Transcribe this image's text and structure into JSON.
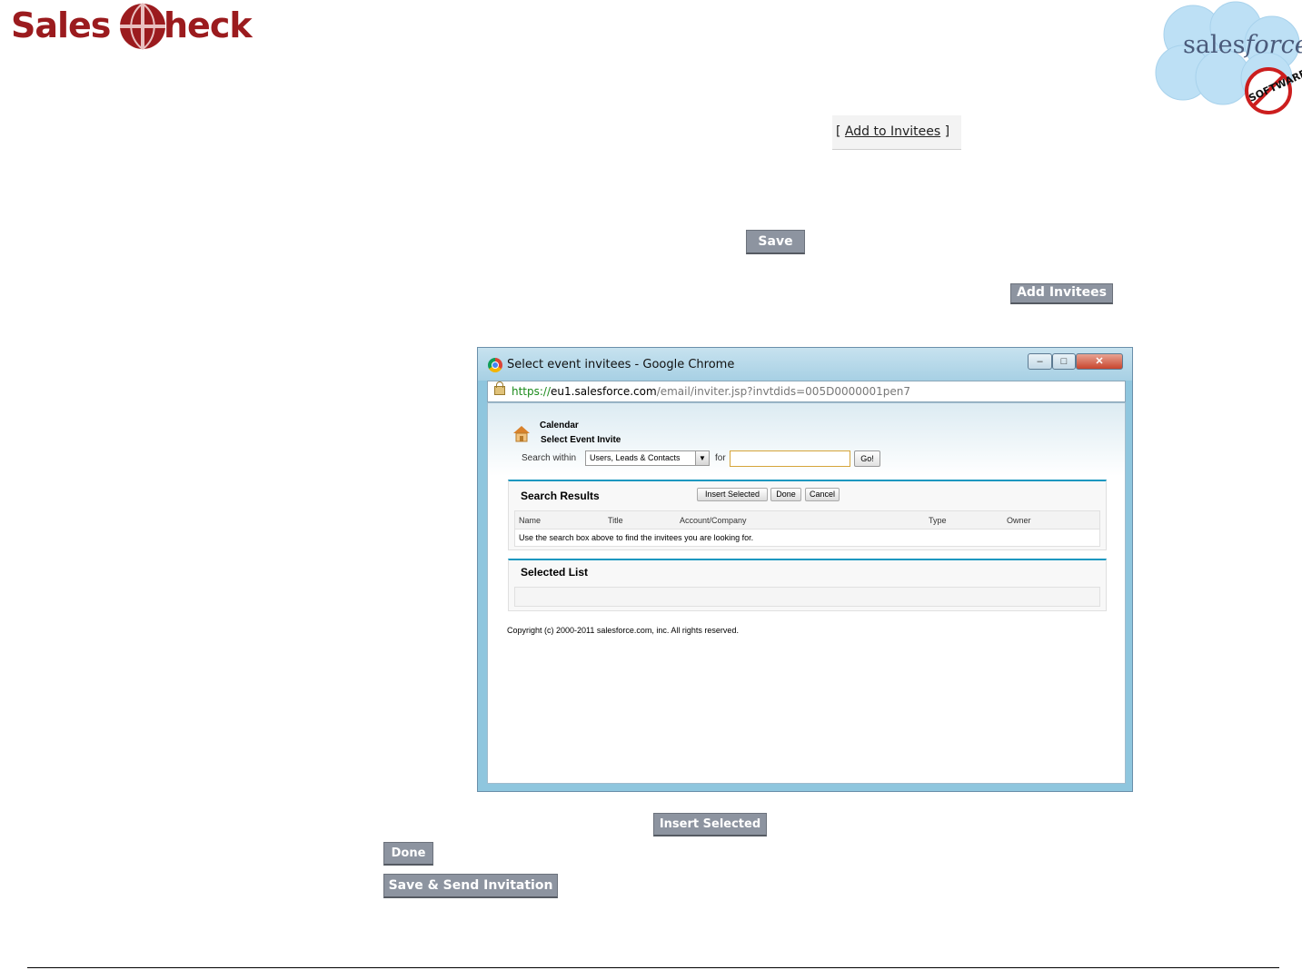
{
  "header": {
    "logo_left_a": "Sales",
    "logo_left_b": "heck",
    "logo_right_a": "sales",
    "logo_right_b": "force",
    "logo_right_stamp": "SOFTWARE"
  },
  "link_add_to_invitees": {
    "open": "[ ",
    "label": "Add to Invitees",
    "close": " ]"
  },
  "buttons": {
    "save": "Save",
    "add_invitees": "Add Invitees",
    "insert_selected": "Insert Selected",
    "done": "Done",
    "save_send": "Save & Send Invitation"
  },
  "popup": {
    "window_title": "Select event invitees - Google Chrome",
    "url_https": "https://",
    "url_host": "eu1.salesforce.com",
    "url_path": "/email/inviter.jsp?invtdids=005D0000001pen7",
    "breadcrumb": "Calendar",
    "page_title": "Select Event Invite",
    "search_within_label": "Search within",
    "search_within_value": "Users, Leads & Contacts",
    "for_label": "for",
    "search_value": "",
    "go_label": "Go!",
    "search_results": {
      "title": "Search Results",
      "insert_selected": "Insert Selected",
      "done": "Done",
      "cancel": "Cancel",
      "columns": [
        "Name",
        "Title",
        "Account/Company",
        "Type",
        "Owner"
      ],
      "empty_message": "Use the search box above to find the invitees you are looking for."
    },
    "selected_list": {
      "title": "Selected List"
    },
    "copyright": "Copyright (c) 2000-2011 salesforce.com, inc. All rights reserved."
  }
}
